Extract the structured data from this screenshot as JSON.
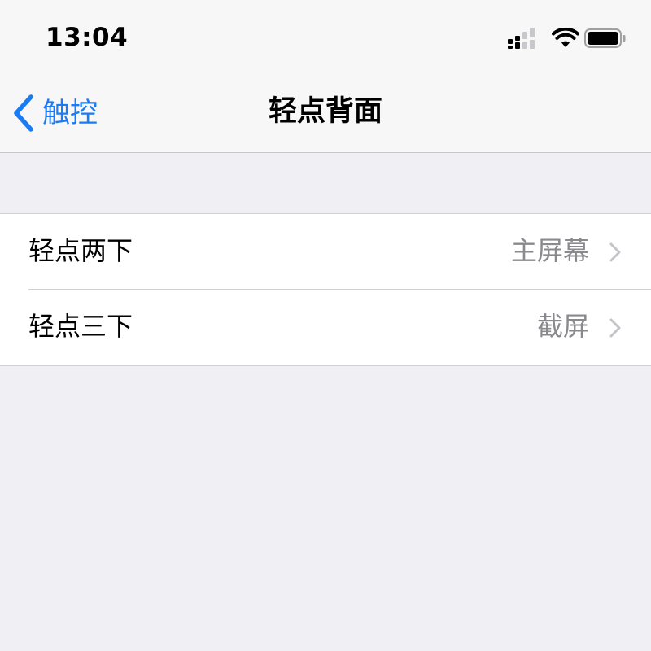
{
  "status_bar": {
    "time": "13:04",
    "icons": [
      "cellular-signal-icon",
      "wifi-icon",
      "battery-icon"
    ]
  },
  "nav": {
    "back_label": "触控",
    "title": "轻点背面",
    "back_icon": "chevron-left-icon"
  },
  "colors": {
    "accent": "#1a7cf4",
    "background": "#efeff4",
    "secondary_text": "#8a8a8e"
  },
  "settings": [
    {
      "label": "轻点两下",
      "value": "主屏幕"
    },
    {
      "label": "轻点三下",
      "value": "截屏"
    }
  ]
}
